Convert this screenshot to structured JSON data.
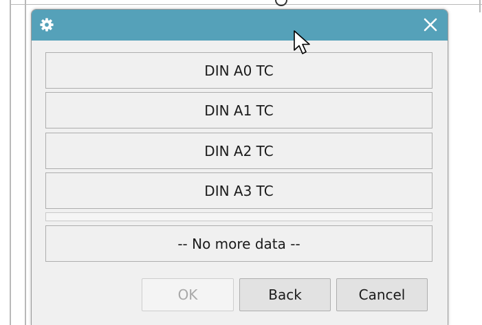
{
  "dialog": {
    "header_color": "#55a1b9",
    "header_icon": "gear-icon",
    "close_icon": "close-icon"
  },
  "list": {
    "items": [
      {
        "label": "DIN A0 TC"
      },
      {
        "label": "DIN A1 TC"
      },
      {
        "label": "DIN A2 TC"
      },
      {
        "label": "DIN A3 TC"
      }
    ],
    "footer_label": "-- No more data --"
  },
  "buttons": {
    "ok_label": "OK",
    "back_label": "Back",
    "cancel_label": "Cancel"
  }
}
